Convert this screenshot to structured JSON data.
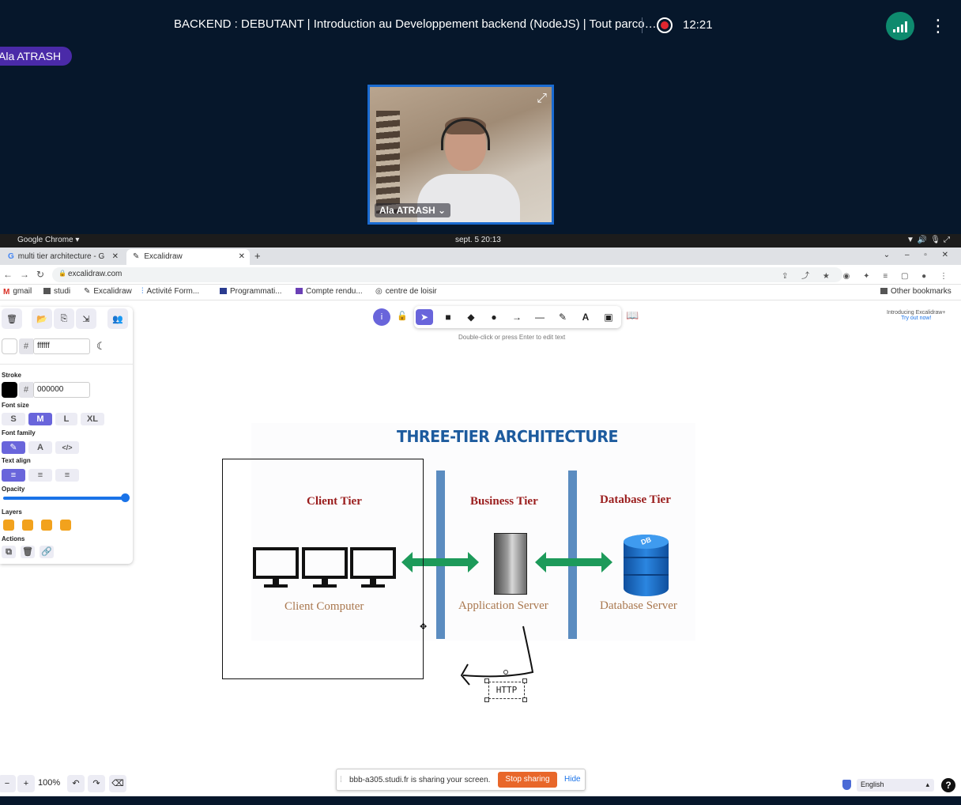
{
  "meeting": {
    "title": "BACKEND : DEBUTANT | Introduction au Developpement backend (NodeJS) | Tout parco…",
    "timer": "12:21",
    "presenter_tag": "Ala ATRASH",
    "video_name": "Ala ATRASH ⌄"
  },
  "os_bar": {
    "app": "Google Chrome ▾",
    "clock": "sept. 5  20:13"
  },
  "browser": {
    "tabs": [
      {
        "label": "multi tier architecture - G"
      },
      {
        "label": "Excalidraw"
      }
    ],
    "url": "excalidraw.com",
    "bookmarks": [
      "gmail",
      "studi",
      "Excalidraw",
      "Activité Form...",
      "Programmati...",
      "Compte rendu...",
      "centre de loisir"
    ],
    "other_bookmarks": "Other bookmarks"
  },
  "excalidraw": {
    "canvas_bg_hex": "ffffff",
    "stroke_label": "Stroke",
    "stroke_hex": "000000",
    "font_size_label": "Font size",
    "font_sizes": [
      "S",
      "M",
      "L",
      "XL"
    ],
    "font_family_label": "Font family",
    "text_align_label": "Text align",
    "opacity_label": "Opacity",
    "opacity": 1.0,
    "layers_label": "Layers",
    "actions_label": "Actions",
    "hint": "Double-click or press Enter to edit text",
    "promo_line1": "Introducing Excalidraw+",
    "promo_line2": "Try out now!",
    "zoom": "100%",
    "language": "English"
  },
  "diagram": {
    "title": "THREE-TIER ARCHITECTURE",
    "client_tier": "Client Tier",
    "business_tier": "Business Tier",
    "database_tier": "Database Tier",
    "client_computer": "Client Computer",
    "application_server": "Application Server",
    "database_server": "Database Server",
    "db_badge": "DB",
    "http_text": "HTTP"
  },
  "share_bar": {
    "message": "bbb-a305.studi.fr is sharing your screen.",
    "stop": "Stop sharing",
    "hide": "Hide"
  },
  "colors": {
    "accent": "#6965db",
    "conference_bg": "#06172b",
    "stop_button": "#e8672a",
    "network_ok": "#0e8a6e"
  }
}
